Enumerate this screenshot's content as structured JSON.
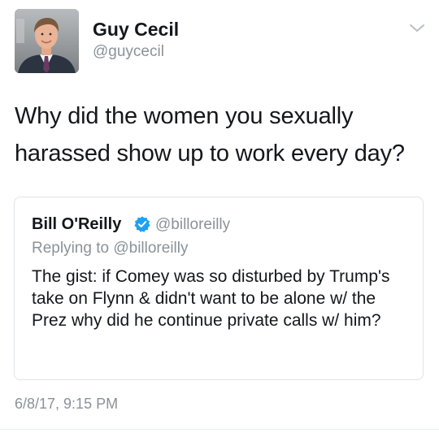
{
  "tweet": {
    "author": {
      "name": "Guy Cecil",
      "handle": "@guycecil"
    },
    "text": "Why did the women you sexually harassed show up to work every day?",
    "timestamp": "6/8/17, 9:15 PM",
    "menu_icon": "chevron-down-icon"
  },
  "quoted_tweet": {
    "author": {
      "name": "Bill O'Reilly",
      "handle": "@billoreilly",
      "verified": true
    },
    "replying_to": "Replying to @billoreilly",
    "text": "The gist: if Comey was so disturbed by Trump's take on Flynn & didn't want to be alone w/ the Prez why did he continue private calls w/ him?"
  },
  "colors": {
    "text_primary": "#14171a",
    "text_secondary": "#8a9299",
    "verified_blue": "#1da1f2",
    "border": "#dfe3e7"
  }
}
